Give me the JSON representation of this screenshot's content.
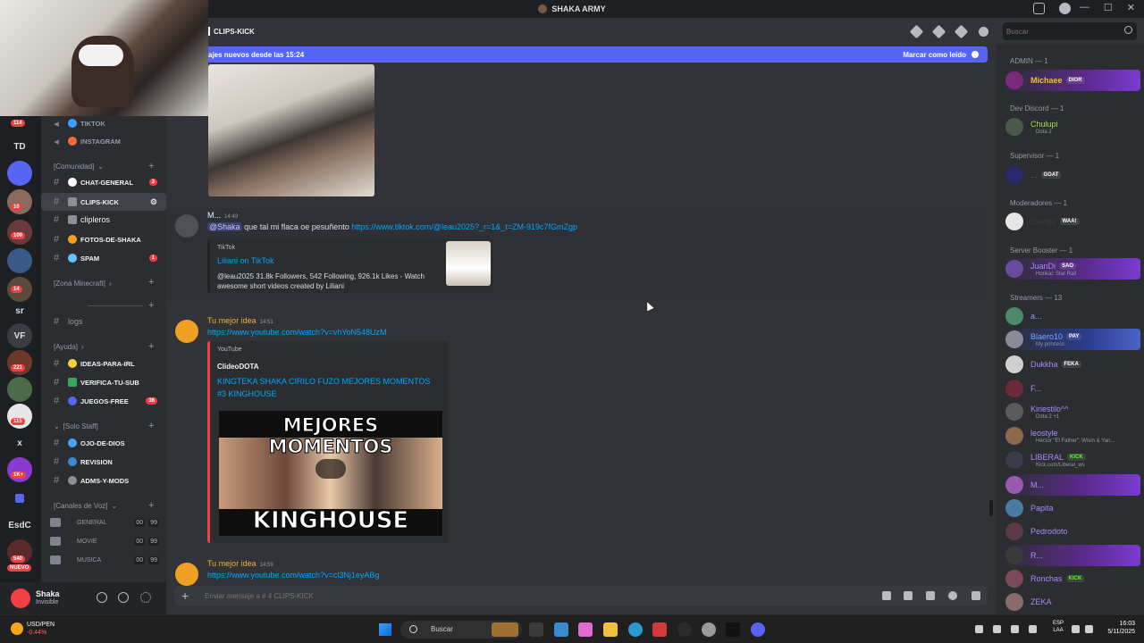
{
  "window": {
    "title": "SHAKA ARMY",
    "controls": [
      "—",
      "☐",
      "✕"
    ]
  },
  "rail": {
    "badges": [
      "114",
      "10",
      "109",
      "14",
      "221",
      "115",
      "1K+",
      "540",
      "NUEVO"
    ],
    "labels": [
      "TD",
      "sr",
      "VF",
      "x",
      "EsdC"
    ]
  },
  "sidebar": {
    "top_channels": [
      {
        "name": "TIKTOK"
      },
      {
        "name": "INSTAGRAM"
      }
    ],
    "categories": {
      "comunidad": "[Comunidad]",
      "minecraft": "[Zona Minecraft]",
      "ayuda": "[Ayuda]",
      "staff": "[Solo Staff]",
      "voz": "[Canales de Voz]"
    },
    "comunidad_channels": [
      {
        "name": "CHAT-GENERAL",
        "count": "3"
      },
      {
        "name": "CLIPS-KICK"
      },
      {
        "name": "clipleros"
      },
      {
        "name": "FOTOS-DE-SHAKA"
      },
      {
        "name": "SPAM",
        "count": "1"
      }
    ],
    "logs": "logs",
    "ayuda_channels": [
      {
        "name": "IDEAS-PARA-IRL"
      },
      {
        "name": "VERIFICA-TU-SUB"
      },
      {
        "name": "JUEGOS-FREE",
        "count": "36"
      }
    ],
    "staff_channels": [
      {
        "name": "OJO-DE-DIOS"
      },
      {
        "name": "REVISION"
      },
      {
        "name": "ADMS-Y-MODS"
      }
    ],
    "voice_channels": [
      {
        "name": "GENERAL",
        "a": "00",
        "b": "99"
      },
      {
        "name": "MOVIE",
        "a": "00",
        "b": "99"
      },
      {
        "name": "MUSICA",
        "a": "00",
        "b": "99"
      }
    ]
  },
  "user": {
    "name": "Shaka",
    "status": "Invisible"
  },
  "channel": {
    "name": "CLIPS-KICK"
  },
  "search": {
    "placeholder": "Buscar"
  },
  "new_messages": {
    "text": "ajes nuevos desde las 15:24",
    "mark_read": "Marcar como leído"
  },
  "messages": [
    {
      "author": "M...",
      "time": "14:49",
      "mention": "@Shaka",
      "text": "que tal mi flaca oe pesuñento",
      "link": "https://www.tiktok.com/@leau2025?_r=1&_t=ZM-919c7fGmZgp",
      "embed": {
        "provider": "TikTok",
        "title": "Liliani on TikTok",
        "desc_line1": "@leau2025 31.8k Followers, 542 Following, 926.1k Likes - Watch",
        "desc_line2": "awesome short videos created by Liliani"
      }
    },
    {
      "author": "Tu mejor idea",
      "time": "14:51",
      "link": "https://www.youtube.com/watch?v=vhYoN548UzM",
      "embed": {
        "provider": "YouTube",
        "author": "ClideoDOTA",
        "title_line1": "KINGTEKA SHAKA CIRILO FUZO MEJORES MOMENTOS",
        "title_line2": "#3 KINGHOUSE",
        "thumb_top": "MEJORES MOMENTOS",
        "thumb_bottom": "KINGHOUSE"
      }
    },
    {
      "author": "Tu mejor idea",
      "time": "14:59",
      "link": "https://www.youtube.com/watch?v=cl3Nj1eyABg"
    }
  ],
  "composer": {
    "placeholder": "Enviar mensaje a # 4 CLIPS-KICK"
  },
  "members": {
    "groups": [
      {
        "label": "ADMIN — 1"
      },
      {
        "label": "Dev Discord — 1"
      },
      {
        "label": "Supervisor — 1"
      },
      {
        "label": "Moderadores — 1"
      },
      {
        "label": "Server Booster — 1"
      },
      {
        "label": "Streamers — 13"
      }
    ],
    "list": [
      {
        "name": "Michaee",
        "tag": "DIOR",
        "color": "#f0c040"
      },
      {
        "name": "Chulupi",
        "sub": "Dota 2",
        "color": "#9be34a"
      },
      {
        "name": "...",
        "tag": "GOAT",
        "color": "#e0433b"
      },
      {
        "name": "!Sadge",
        "tag": "WAA!",
        "color": "#3a3c41"
      },
      {
        "name": "JuanDi",
        "tag": "SAO",
        "sub": "Honkai: Star Rail",
        "color": "#a78bfa"
      },
      {
        "name": "a...",
        "color": "#a78bfa"
      },
      {
        "name": "Blaero10",
        "tag": "PAY",
        "sub": "My princess",
        "color": "#7aa7ff"
      },
      {
        "name": "Dukkha",
        "tag": "FEKA",
        "color": "#a78bfa"
      },
      {
        "name": "F...",
        "color": "#a78bfa"
      },
      {
        "name": "Kiriestilo^^",
        "sub": "Dota 2 +1",
        "color": "#a78bfa"
      },
      {
        "name": "leostyle",
        "sub": "Héctor \"El Father\", Wisin & Yan...",
        "color": "#a78bfa"
      },
      {
        "name": "LIBERAL",
        "tag": "KICK",
        "sub": "Kick.com/Liberal_ws",
        "color": "#a78bfa"
      },
      {
        "name": "M...",
        "color": "#a78bfa"
      },
      {
        "name": "Papita",
        "color": "#a78bfa"
      },
      {
        "name": "Pedrodoto",
        "color": "#a78bfa"
      },
      {
        "name": "R...",
        "color": "#a78bfa"
      },
      {
        "name": "Ronchas",
        "tag": "KICK",
        "color": "#a78bfa"
      },
      {
        "name": "ZEKA",
        "color": "#a78bfa"
      }
    ]
  },
  "taskbar": {
    "stock_name": "USD/PEN",
    "stock_change": "-0.44%",
    "search": "Buscar",
    "lang1": "ESP",
    "lang2": "LAA",
    "time": "16:03",
    "date": "5/11/2025"
  }
}
